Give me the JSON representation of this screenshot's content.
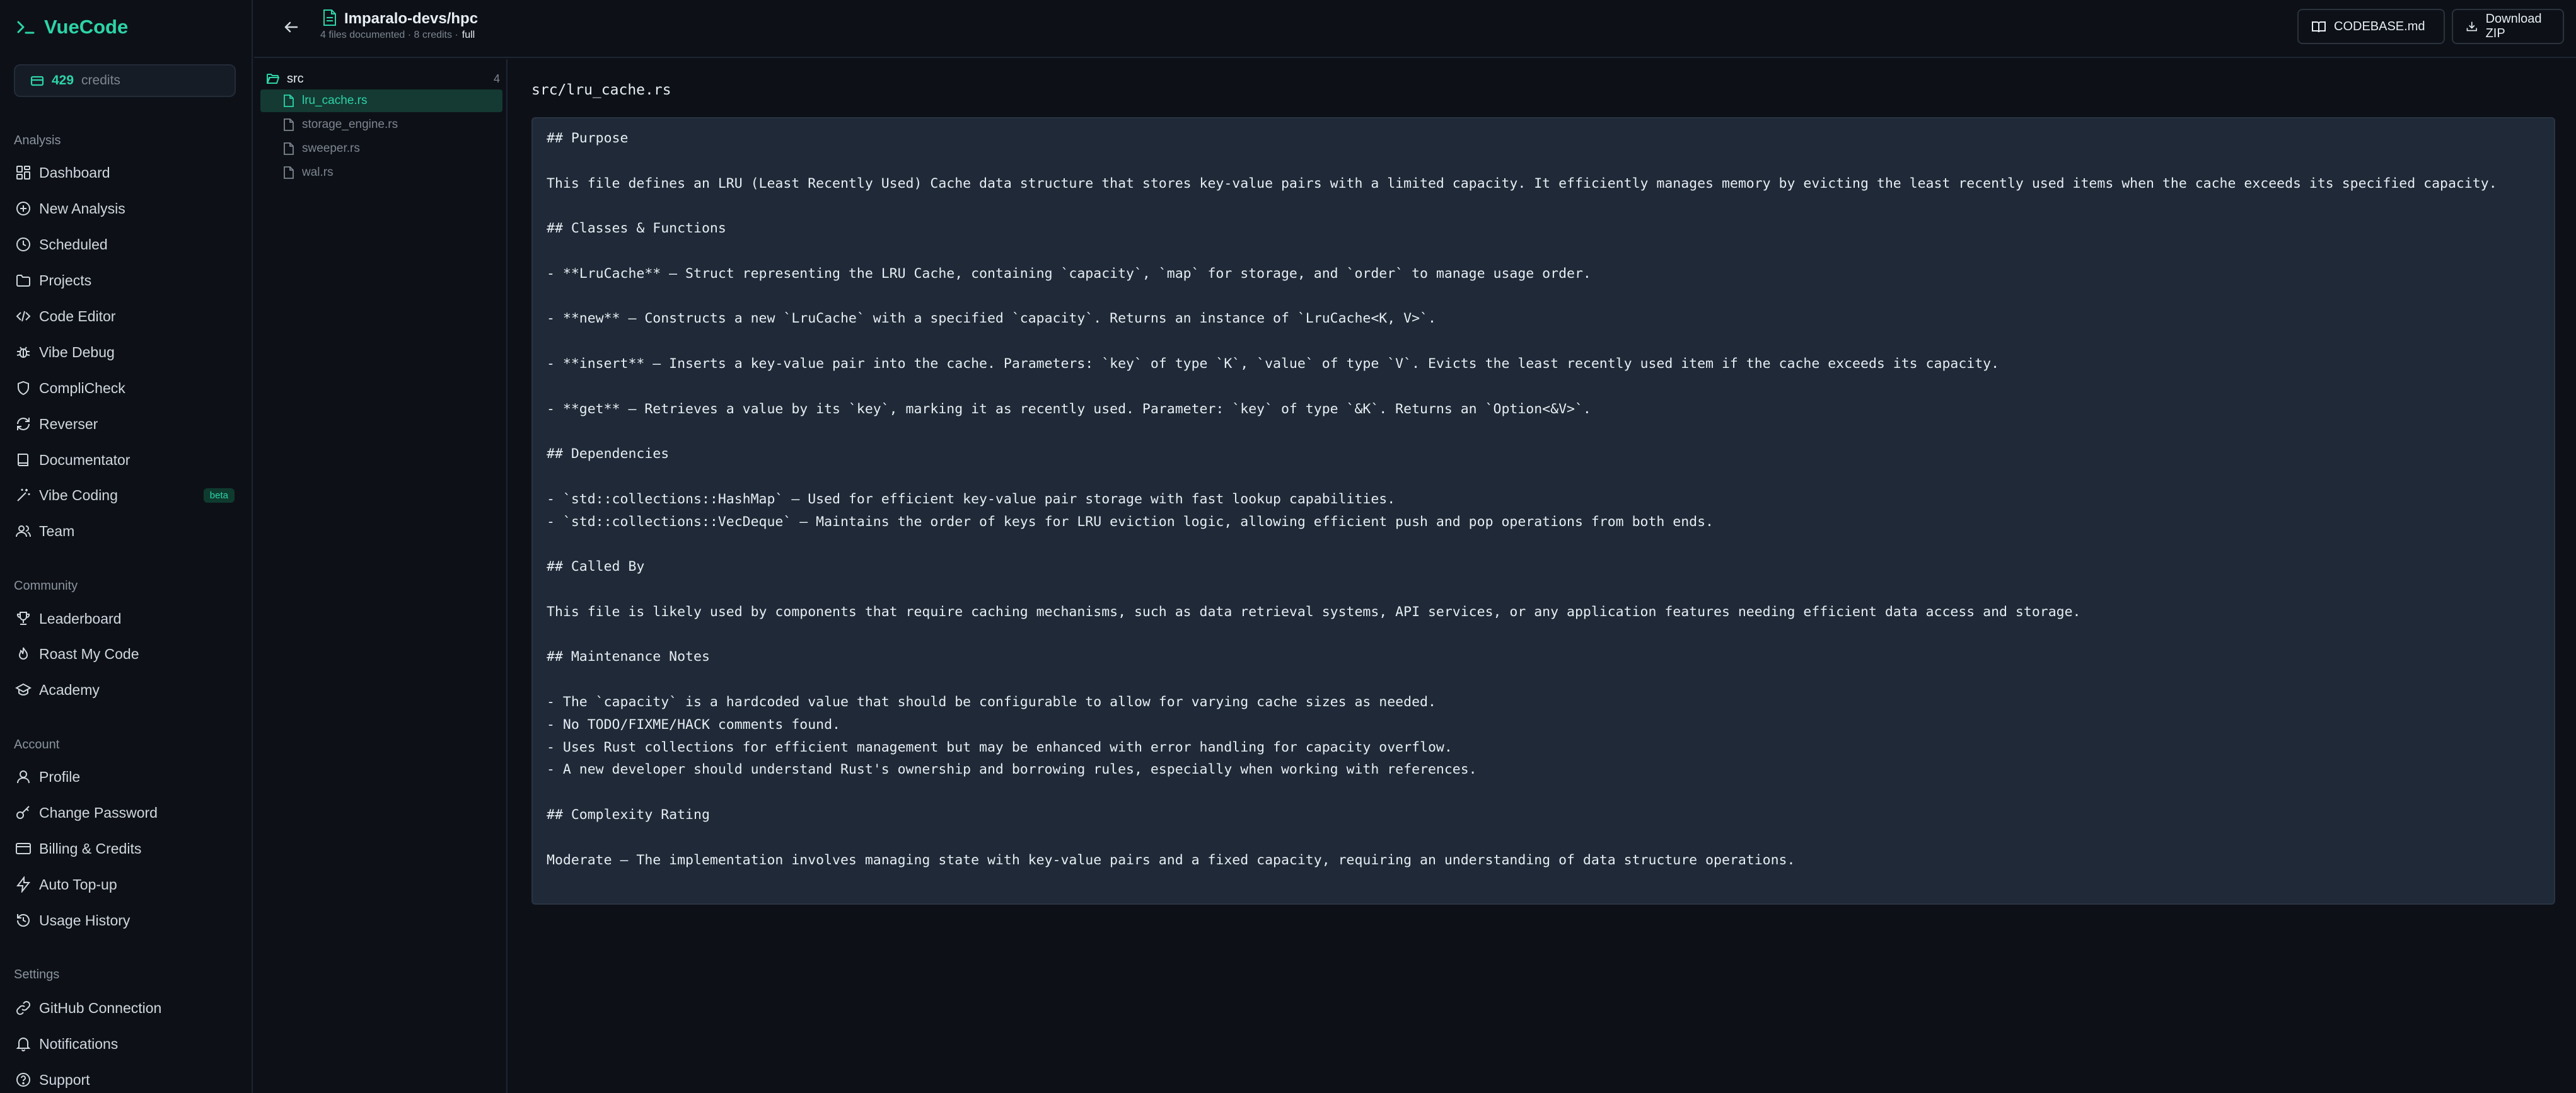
{
  "app": {
    "name": "VueCode"
  },
  "credits": {
    "value": "429",
    "label": "credits"
  },
  "sidebar": {
    "sections": [
      {
        "label": "Analysis",
        "items": [
          {
            "label": "Dashboard",
            "icon": "dashboard-icon"
          },
          {
            "label": "New Analysis",
            "icon": "plus-circle-icon"
          },
          {
            "label": "Scheduled",
            "icon": "clock-icon"
          },
          {
            "label": "Projects",
            "icon": "folder-icon"
          },
          {
            "label": "Code Editor",
            "icon": "code-icon"
          },
          {
            "label": "Vibe Debug",
            "icon": "bug-icon"
          },
          {
            "label": "CompliCheck",
            "icon": "shield-icon"
          },
          {
            "label": "Reverser",
            "icon": "reverse-icon"
          },
          {
            "label": "Documentator",
            "icon": "book-icon"
          },
          {
            "label": "Vibe Coding",
            "icon": "wand-icon",
            "badge": "beta"
          },
          {
            "label": "Team",
            "icon": "users-icon"
          }
        ]
      },
      {
        "label": "Community",
        "items": [
          {
            "label": "Leaderboard",
            "icon": "trophy-icon"
          },
          {
            "label": "Roast My Code",
            "icon": "flame-icon"
          },
          {
            "label": "Academy",
            "icon": "graduation-icon"
          }
        ]
      },
      {
        "label": "Account",
        "items": [
          {
            "label": "Profile",
            "icon": "user-icon"
          },
          {
            "label": "Change Password",
            "icon": "key-icon"
          },
          {
            "label": "Billing & Credits",
            "icon": "card-icon"
          },
          {
            "label": "Auto Top-up",
            "icon": "zap-icon"
          },
          {
            "label": "Usage History",
            "icon": "history-icon"
          }
        ]
      },
      {
        "label": "Settings",
        "items": [
          {
            "label": "GitHub Connection",
            "icon": "link-icon"
          },
          {
            "label": "Notifications",
            "icon": "bell-icon"
          },
          {
            "label": "Support",
            "icon": "help-icon"
          }
        ]
      }
    ]
  },
  "header": {
    "repo": "Imparalo-devs/hpc",
    "subtitle": "4 files documented · 8 credits ·",
    "mode": "full",
    "buttons": {
      "codebase": "CODEBASE.md",
      "download": "Download ZIP"
    }
  },
  "tree": {
    "folder": "src",
    "count": "4",
    "files": [
      "lru_cache.rs",
      "storage_engine.rs",
      "sweeper.rs",
      "wal.rs"
    ],
    "active": "lru_cache.rs"
  },
  "document": {
    "path": "src/lru_cache.rs",
    "content": "## Purpose\n\nThis file defines an LRU (Least Recently Used) Cache data structure that stores key-value pairs with a limited capacity. It efficiently manages memory by evicting the least recently used items when the cache exceeds its specified capacity.\n\n## Classes & Functions\n\n- **LruCache** — Struct representing the LRU Cache, containing `capacity`, `map` for storage, and `order` to manage usage order.\n\n- **new** — Constructs a new `LruCache` with a specified `capacity`. Returns an instance of `LruCache<K, V>`.\n\n- **insert** — Inserts a key-value pair into the cache. Parameters: `key` of type `K`, `value` of type `V`. Evicts the least recently used item if the cache exceeds its capacity.\n\n- **get** — Retrieves a value by its `key`, marking it as recently used. Parameter: `key` of type `&K`. Returns an `Option<&V>`.\n\n## Dependencies\n\n- `std::collections::HashMap` — Used for efficient key-value pair storage with fast lookup capabilities.\n- `std::collections::VecDeque` — Maintains the order of keys for LRU eviction logic, allowing efficient push and pop operations from both ends.\n\n## Called By\n\nThis file is likely used by components that require caching mechanisms, such as data retrieval systems, API services, or any application features needing efficient data access and storage.\n\n## Maintenance Notes\n\n- The `capacity` is a hardcoded value that should be configurable to allow for varying cache sizes as needed.\n- No TODO/FIXME/HACK comments found.\n- Uses Rust collections for efficient management but may be enhanced with error handling for capacity overflow.\n- A new developer should understand Rust's ownership and borrowing rules, especially when working with references.\n\n## Complexity Rating\n\nModerate — The implementation involves managing state with key-value pairs and a fixed capacity, requiring an understanding of data structure operations."
  },
  "colors": {
    "accent": "#2dd4a8",
    "background": "#0d1117",
    "panel": "#1f2937"
  }
}
